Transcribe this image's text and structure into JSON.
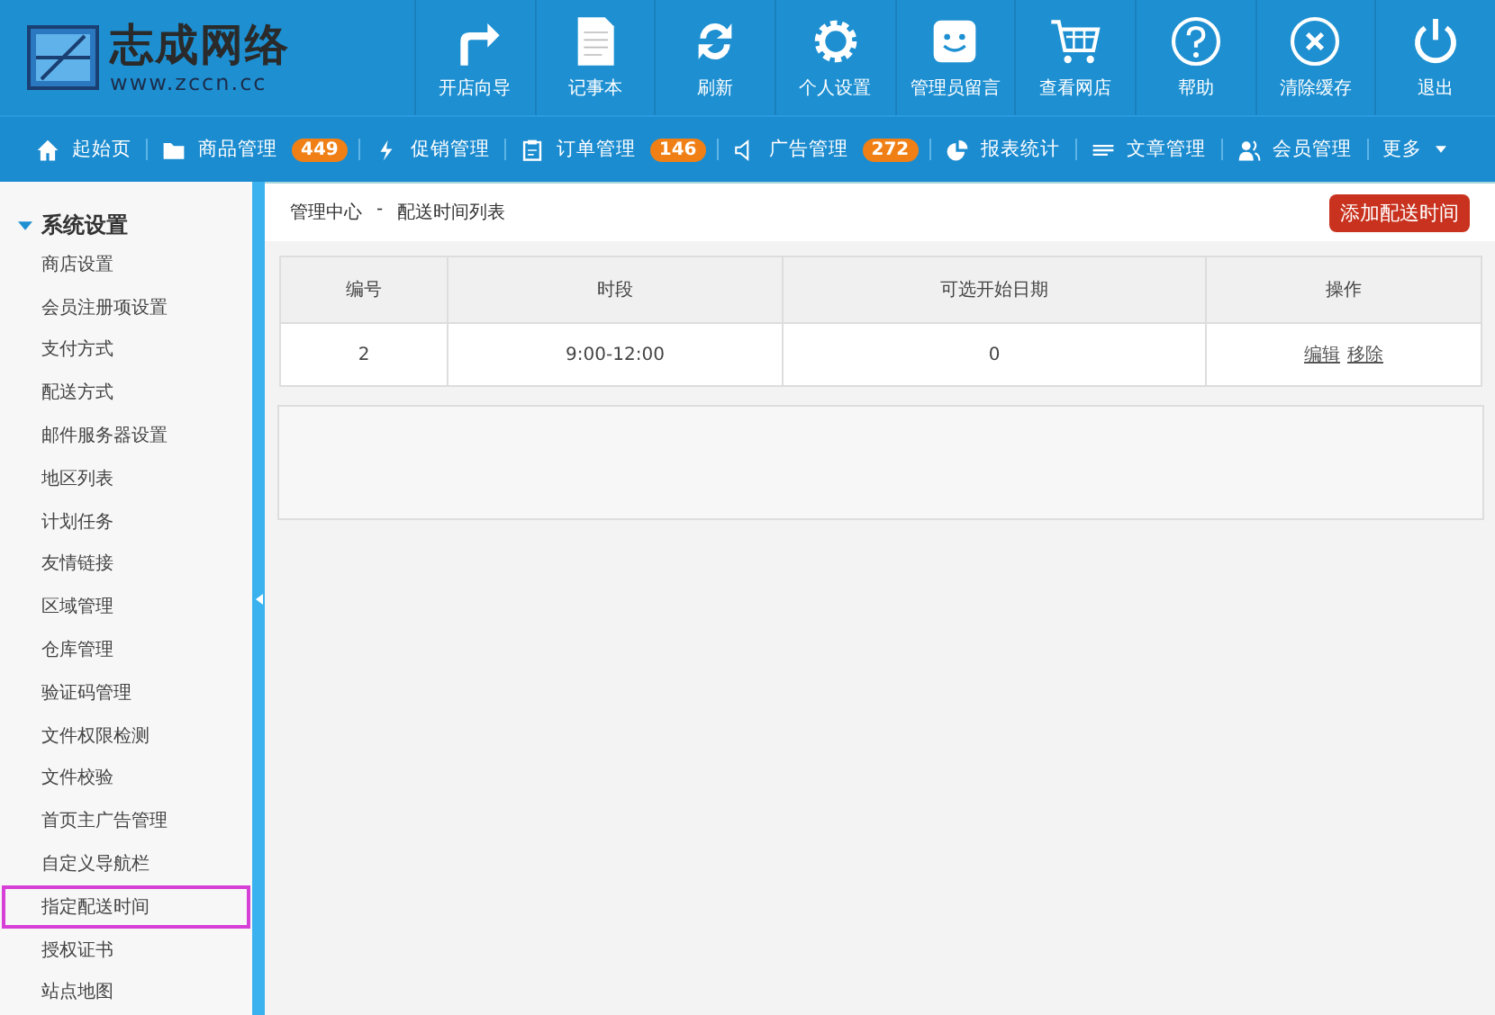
{
  "logo": {
    "name": "志成网络",
    "url": "www.zccn.cc"
  },
  "toolbar": [
    "开店向导",
    "记事本",
    "刷新",
    "个人设置",
    "管理员留言",
    "查看网店",
    "帮助",
    "清除缓存",
    "退出"
  ],
  "nav": [
    {
      "label": "起始页"
    },
    {
      "label": "商品管理",
      "badge": "449"
    },
    {
      "label": "促销管理"
    },
    {
      "label": "订单管理",
      "badge": "146"
    },
    {
      "label": "广告管理",
      "badge": "272"
    },
    {
      "label": "报表统计"
    },
    {
      "label": "文章管理"
    },
    {
      "label": "会员管理"
    },
    {
      "label": "更多",
      "dropdown": true
    }
  ],
  "sidebar": {
    "section": "系统设置",
    "expanded": true,
    "items": [
      {
        "label": "商店设置",
        "selected": false
      },
      {
        "label": "会员注册项设置",
        "selected": false
      },
      {
        "label": "支付方式",
        "selected": false
      },
      {
        "label": "配送方式",
        "selected": false
      },
      {
        "label": "邮件服务器设置",
        "selected": false
      },
      {
        "label": "地区列表",
        "selected": false
      },
      {
        "label": "计划任务",
        "selected": false
      },
      {
        "label": "友情链接",
        "selected": false
      },
      {
        "label": "区域管理",
        "selected": false
      },
      {
        "label": "仓库管理",
        "selected": false
      },
      {
        "label": "验证码管理",
        "selected": false
      },
      {
        "label": "文件权限检测",
        "selected": false
      },
      {
        "label": "文件校验",
        "selected": false
      },
      {
        "label": "首页主广告管理",
        "selected": false
      },
      {
        "label": "自定义导航栏",
        "selected": false
      },
      {
        "label": "指定配送时间",
        "selected": true
      },
      {
        "label": "授权证书",
        "selected": false
      },
      {
        "label": "站点地图",
        "selected": false
      }
    ]
  },
  "breadcrumb": [
    "管理中心",
    "-",
    "配送时间列表"
  ],
  "add_button": "添加配送时间",
  "table": {
    "columns": [
      "编号",
      "时段",
      "可选开始日期",
      "操作"
    ],
    "rows": [
      {
        "cells": [
          "2",
          "9:00-12:00",
          "0"
        ],
        "actions": [
          "编辑",
          "移除"
        ]
      }
    ]
  }
}
